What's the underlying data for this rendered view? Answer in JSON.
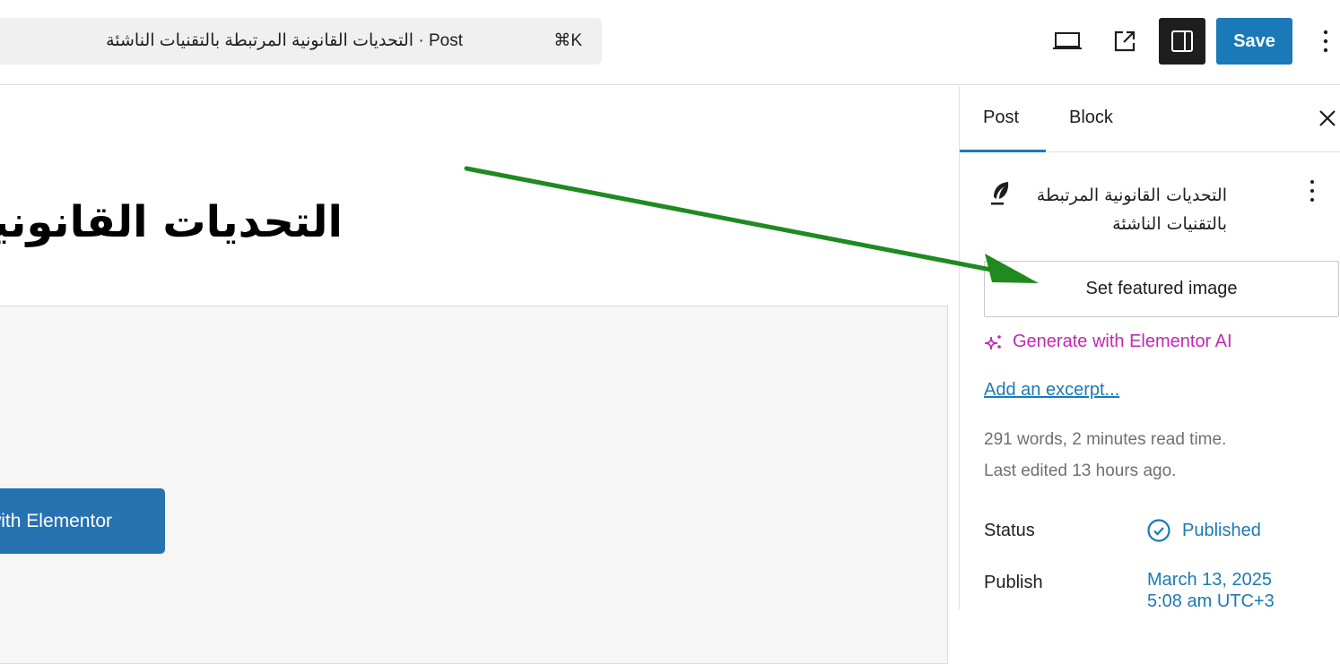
{
  "topbar": {
    "command_title": "التحديات القانونية المرتبطة بالتقنيات الناشئة · Post",
    "shortcut": "⌘K",
    "icons": [
      "desktop-view-icon",
      "external-link-icon",
      "sidebar-panel-icon"
    ],
    "save_label": "Save",
    "more_icon": "vertical-ellipsis-icon"
  },
  "editor": {
    "post_title": "التحديات القانونية المرتبطة بالتقنيات الناشئة",
    "elementor_button_label": "Edit with Elementor"
  },
  "sidebar": {
    "tabs": [
      {
        "label": "Post",
        "active": true
      },
      {
        "label": "Block",
        "active": false
      }
    ],
    "close_icon": "close-icon",
    "post_icon": "feather-icon",
    "post_name": "التحديات القانونية المرتبطة بالتقنيات الناشئة",
    "featured_image_label": "Set featured image",
    "ai_label": "Generate with Elementor AI",
    "excerpt_label": "Add an excerpt...",
    "word_count": "291 words, 2 minutes read time.",
    "last_edited": "Last edited 13 hours ago.",
    "status_label": "Status",
    "status_value": "Published",
    "publish_label": "Publish",
    "publish_date": "March 13, 2025",
    "publish_time": "5:08 am UTC+3"
  },
  "annotation": {
    "arrow_color": "#1f8a1f",
    "target": "Set featured image"
  },
  "colors": {
    "accent": "#1a7ab8",
    "ai": "#c427b6",
    "elementor_button": "#2772b0"
  }
}
